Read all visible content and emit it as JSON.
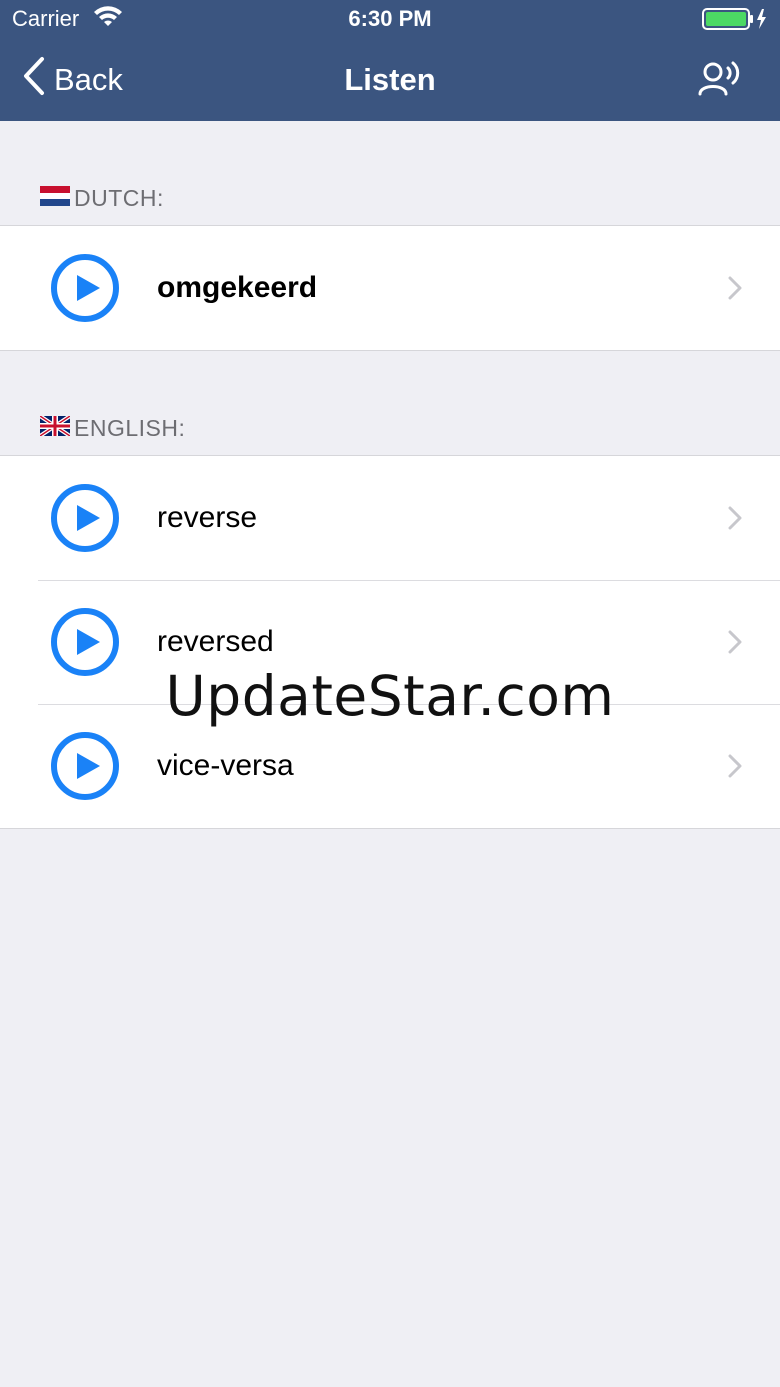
{
  "status_bar": {
    "carrier": "Carrier",
    "time": "6:30 PM",
    "battery_color": "#4cd964"
  },
  "nav": {
    "back_label": "Back",
    "title": "Listen",
    "right_icon": "speaker-person-icon"
  },
  "sections": [
    {
      "header": "DUTCH:",
      "flag": "netherlands-flag",
      "items": [
        {
          "word": "omgekeerd",
          "bold": true
        }
      ]
    },
    {
      "header": "ENGLISH:",
      "flag": "uk-flag",
      "items": [
        {
          "word": "reverse"
        },
        {
          "word": "reversed"
        },
        {
          "word": "vice-versa"
        }
      ]
    }
  ],
  "watermark": "UpdateStar.com",
  "colors": {
    "header_bg": "#3b5580",
    "accent": "#1a82f7",
    "background": "#efeff4"
  }
}
